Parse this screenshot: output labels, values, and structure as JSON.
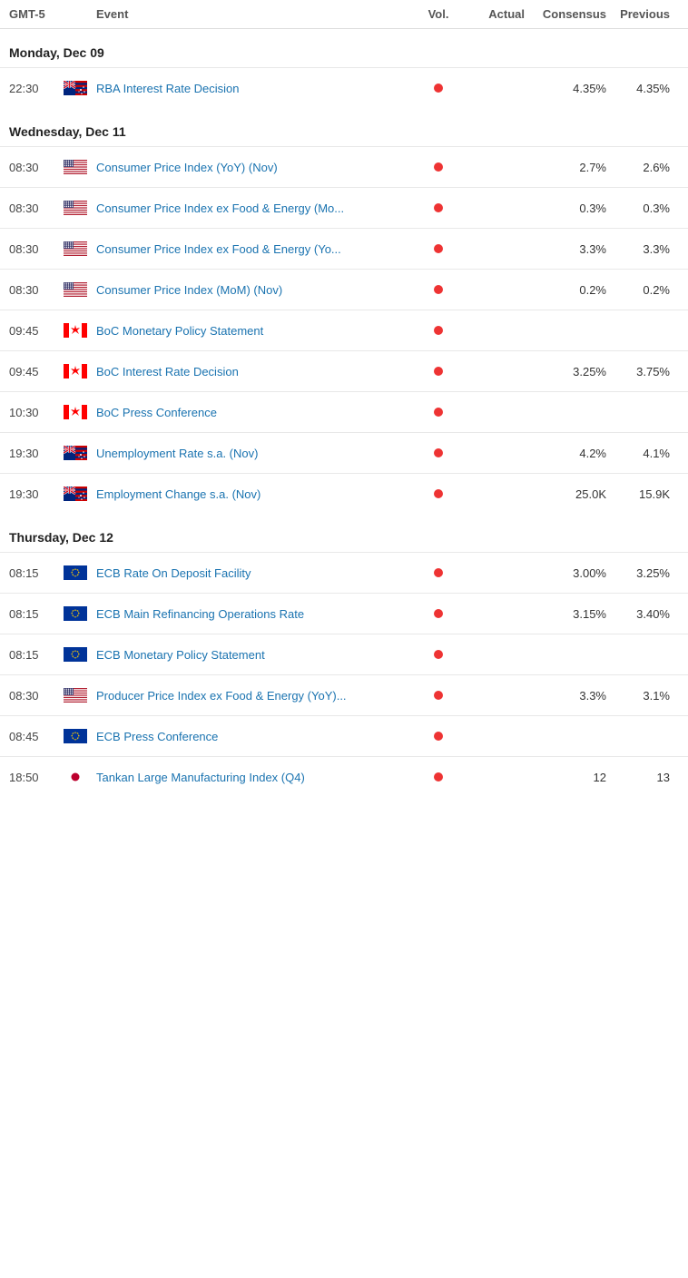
{
  "header": {
    "timezone": "GMT-5",
    "col_event": "Event",
    "col_vol": "Vol.",
    "col_actual": "Actual",
    "col_consensus": "Consensus",
    "col_previous": "Previous"
  },
  "days": [
    {
      "label": "Monday, Dec 09",
      "events": [
        {
          "time": "22:30",
          "country": "au",
          "name": "RBA Interest Rate Decision",
          "vol": true,
          "actual": "",
          "consensus": "4.35%",
          "previous": "4.35%"
        }
      ]
    },
    {
      "label": "Wednesday, Dec 11",
      "events": [
        {
          "time": "08:30",
          "country": "us",
          "name": "Consumer Price Index (YoY) (Nov)",
          "vol": true,
          "actual": "",
          "consensus": "2.7%",
          "previous": "2.6%"
        },
        {
          "time": "08:30",
          "country": "us",
          "name": "Consumer Price Index ex Food & Energy (Mo...",
          "vol": true,
          "actual": "",
          "consensus": "0.3%",
          "previous": "0.3%"
        },
        {
          "time": "08:30",
          "country": "us",
          "name": "Consumer Price Index ex Food & Energy (Yo...",
          "vol": true,
          "actual": "",
          "consensus": "3.3%",
          "previous": "3.3%"
        },
        {
          "time": "08:30",
          "country": "us",
          "name": "Consumer Price Index (MoM) (Nov)",
          "vol": true,
          "actual": "",
          "consensus": "0.2%",
          "previous": "0.2%"
        },
        {
          "time": "09:45",
          "country": "ca",
          "name": "BoC Monetary Policy Statement",
          "vol": true,
          "actual": "",
          "consensus": "",
          "previous": ""
        },
        {
          "time": "09:45",
          "country": "ca",
          "name": "BoC Interest Rate Decision",
          "vol": true,
          "actual": "",
          "consensus": "3.25%",
          "previous": "3.75%"
        },
        {
          "time": "10:30",
          "country": "ca",
          "name": "BoC Press Conference",
          "vol": true,
          "actual": "",
          "consensus": "",
          "previous": ""
        },
        {
          "time": "19:30",
          "country": "au",
          "name": "Unemployment Rate s.a. (Nov)",
          "vol": true,
          "actual": "",
          "consensus": "4.2%",
          "previous": "4.1%"
        },
        {
          "time": "19:30",
          "country": "au",
          "name": "Employment Change s.a. (Nov)",
          "vol": true,
          "actual": "",
          "consensus": "25.0K",
          "previous": "15.9K"
        }
      ]
    },
    {
      "label": "Thursday, Dec 12",
      "events": [
        {
          "time": "08:15",
          "country": "eu",
          "name": "ECB Rate On Deposit Facility",
          "vol": true,
          "actual": "",
          "consensus": "3.00%",
          "previous": "3.25%"
        },
        {
          "time": "08:15",
          "country": "eu",
          "name": "ECB Main Refinancing Operations Rate",
          "vol": true,
          "actual": "",
          "consensus": "3.15%",
          "previous": "3.40%"
        },
        {
          "time": "08:15",
          "country": "eu",
          "name": "ECB Monetary Policy Statement",
          "vol": true,
          "actual": "",
          "consensus": "",
          "previous": ""
        },
        {
          "time": "08:30",
          "country": "us",
          "name": "Producer Price Index ex Food & Energy (YoY)...",
          "vol": true,
          "actual": "",
          "consensus": "3.3%",
          "previous": "3.1%"
        },
        {
          "time": "08:45",
          "country": "eu",
          "name": "ECB Press Conference",
          "vol": true,
          "actual": "",
          "consensus": "",
          "previous": ""
        },
        {
          "time": "18:50",
          "country": "jp",
          "name": "Tankan Large Manufacturing Index (Q4)",
          "vol": true,
          "actual": "",
          "consensus": "12",
          "previous": "13"
        }
      ]
    }
  ]
}
